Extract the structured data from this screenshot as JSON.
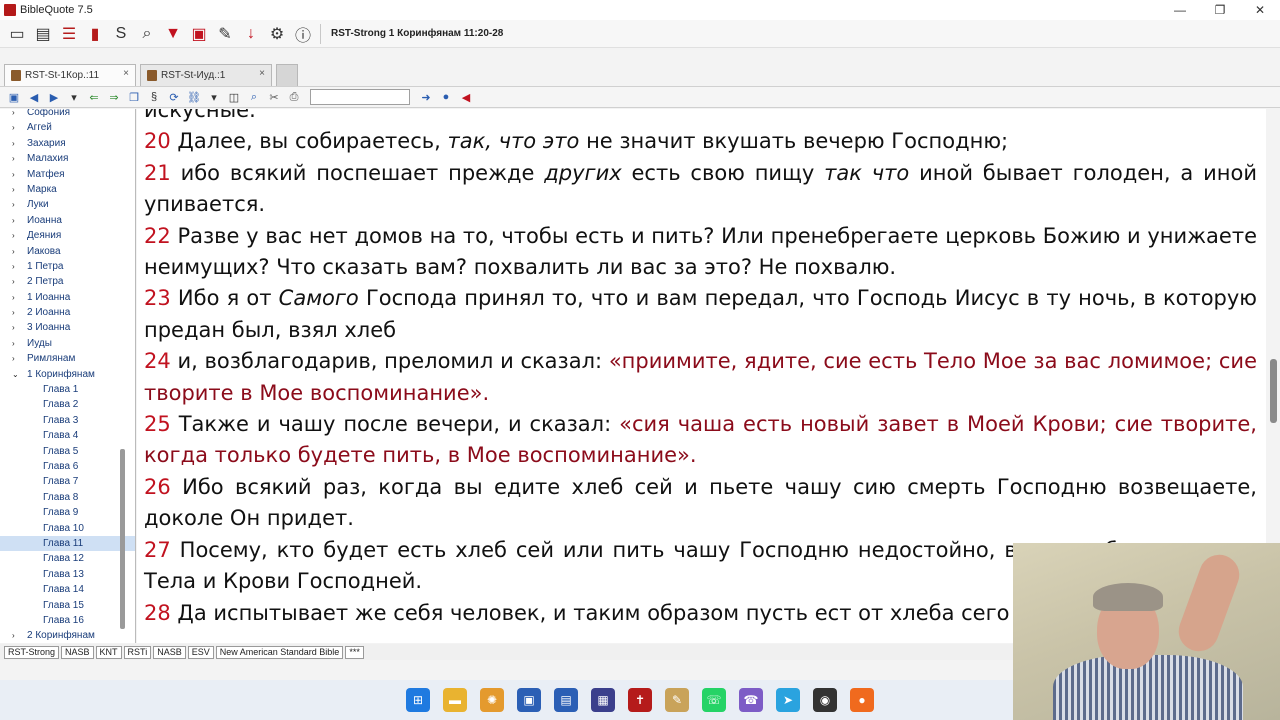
{
  "window": {
    "title": "BibleQuote 7.5"
  },
  "toolbar": {
    "reference": "RST-Strong 1 Коринфянам 11:20-28"
  },
  "tabs": [
    {
      "label": "RST-St-1Кор.:11",
      "close": "×"
    },
    {
      "label": "RST-St-Иуд.:1",
      "close": "×"
    }
  ],
  "sidebar": {
    "items": [
      {
        "label": "Софония",
        "arrow": "›"
      },
      {
        "label": "Аггей",
        "arrow": "›"
      },
      {
        "label": "Захария",
        "arrow": "›"
      },
      {
        "label": "Малахия",
        "arrow": "›"
      },
      {
        "label": "Матфея",
        "arrow": "›"
      },
      {
        "label": "Марка",
        "arrow": "›"
      },
      {
        "label": "Луки",
        "arrow": "›"
      },
      {
        "label": "Иоанна",
        "arrow": "›"
      },
      {
        "label": "Деяния",
        "arrow": "›"
      },
      {
        "label": "Иакова",
        "arrow": "›"
      },
      {
        "label": "1 Петра",
        "arrow": "›"
      },
      {
        "label": "2 Петра",
        "arrow": "›"
      },
      {
        "label": "1 Иоанна",
        "arrow": "›"
      },
      {
        "label": "2 Иоанна",
        "arrow": "›"
      },
      {
        "label": "3 Иоанна",
        "arrow": "›"
      },
      {
        "label": "Иуды",
        "arrow": "›"
      },
      {
        "label": "Римлянам",
        "arrow": "›"
      },
      {
        "label": "1 Коринфянам",
        "arrow": "⌄"
      }
    ],
    "chapters": [
      "Глава 1",
      "Глава 2",
      "Глава 3",
      "Глава 4",
      "Глава 5",
      "Глава 6",
      "Глава 7",
      "Глава 8",
      "Глава 9",
      "Глава 10",
      "Глава 11",
      "Глава 12",
      "Глава 13",
      "Глава 14",
      "Глава 15",
      "Глава 16"
    ],
    "selected_chapter": "Глава 11",
    "last_item": {
      "label": "2 Коринфянам",
      "arrow": "›"
    }
  },
  "verses": {
    "v19_tail": "искусные.",
    "v20": {
      "num": "20",
      "a": "Далее, вы собираетесь, ",
      "i": "так, что это",
      "b": " не значит вкушать вечерю Господню;"
    },
    "v21": {
      "num": "21",
      "a": "ибо всякий поспешает прежде ",
      "i1": "других",
      "b": " есть свою пищу ",
      "i2": "так что",
      "c": " иной бывает голоден, а иной упивается."
    },
    "v22": {
      "num": "22",
      "text": "Разве у вас нет домов на то, чтобы есть и пить? Или пренебрегаете церковь Божию и унижаете неимущих? Что сказать вам? похвалить ли вас за это? Не похвалю."
    },
    "v23": {
      "num": "23",
      "a": "Ибо я от ",
      "i": "Самого",
      "b": " Господа принял то, что и вам передал, что Господь Иисус в ту ночь, в которую предан был, взял хлеб"
    },
    "v24": {
      "num": "24",
      "a": "и, возблагодарив, преломил и сказал: ",
      "j": "«приимите, ядите, сие есть Тело Мое за вас ломимое; сие творите в Мое воспоминание»."
    },
    "v25": {
      "num": "25",
      "a": "Также и чашу после вечери, и сказал: ",
      "j": "«сия чаша есть новый завет в Моей Крови; сие творите, когда только будете пить, в Мое воспоминание»."
    },
    "v26": {
      "num": "26",
      "text": "Ибо всякий раз, когда вы едите хлеб сей и пьете чашу сию смерть Господню возвещаете, доколе Он придет."
    },
    "v27": {
      "num": "27",
      "text": "Посему, кто будет есть хлеб сей или пить чашу Господню недостойно, виновен будет против Тела и Крови Господней."
    },
    "v28": {
      "num": "28",
      "text": "Да испытывает же себя человек, и таким образом пусть ест от хлеба сего и пьет из чаши сей."
    }
  },
  "bottom_tabs": [
    "RST-Strong",
    "NASB",
    "KNT",
    "RSTi",
    "NASB",
    "ESV",
    "New American Standard Bible",
    "***"
  ],
  "window_controls": {
    "minimize": "—",
    "maximize": "❐",
    "close": "✕"
  }
}
